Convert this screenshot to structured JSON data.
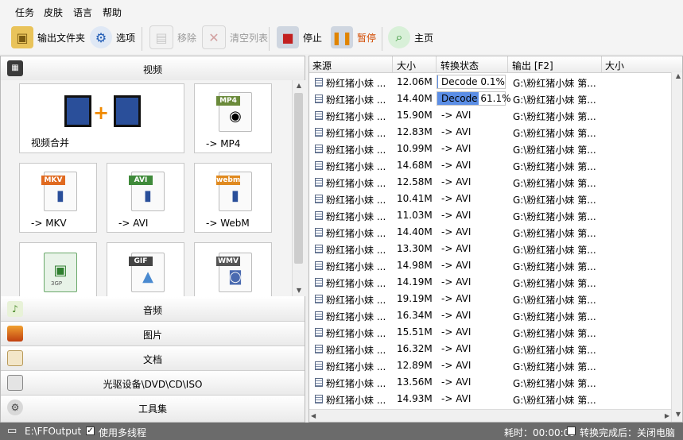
{
  "menu": [
    "任务",
    "皮肤",
    "语言",
    "帮助"
  ],
  "toolbar": {
    "output_folder": "输出文件夹",
    "options": "选项",
    "remove": "移除",
    "clear_list": "清空列表",
    "stop": "停止",
    "pause": "暂停",
    "home": "主页"
  },
  "categories": {
    "video": "视频",
    "audio": "音频",
    "image": "图片",
    "document": "文档",
    "disc": "光驱设备\\DVD\\CD\\ISO",
    "tools": "工具集"
  },
  "tiles": [
    {
      "label": "视频合并",
      "tag": ""
    },
    {
      "label": "-> MP4",
      "tag": "MP4"
    },
    {
      "label": "-> MKV",
      "tag": "MKV"
    },
    {
      "label": "-> AVI",
      "tag": "AVI"
    },
    {
      "label": "-> WebM",
      "tag": "webm"
    },
    {
      "label": "",
      "tag": "3GP"
    },
    {
      "label": "",
      "tag": "GIF"
    },
    {
      "label": "",
      "tag": "WMV"
    }
  ],
  "table": {
    "columns": [
      "来源",
      "大小",
      "转换状态",
      "输出 [F2]",
      "大小"
    ],
    "rows": [
      {
        "source": "粉红猪小妹 ...",
        "size": "12.06M",
        "status": "Decode 0.1%",
        "progress": 0.001,
        "output": "G:\\粉红猪小妹 第..."
      },
      {
        "source": "粉红猪小妹 ...",
        "size": "14.40M",
        "status": "Decode 61.1%",
        "progress": 0.611,
        "output": "G:\\粉红猪小妹 第..."
      },
      {
        "source": "粉红猪小妹 ...",
        "size": "15.90M",
        "status": "-> AVI",
        "output": "G:\\粉红猪小妹 第..."
      },
      {
        "source": "粉红猪小妹 ...",
        "size": "12.83M",
        "status": "-> AVI",
        "output": "G:\\粉红猪小妹 第..."
      },
      {
        "source": "粉红猪小妹 ...",
        "size": "10.99M",
        "status": "-> AVI",
        "output": "G:\\粉红猪小妹 第..."
      },
      {
        "source": "粉红猪小妹 ...",
        "size": "14.68M",
        "status": "-> AVI",
        "output": "G:\\粉红猪小妹 第..."
      },
      {
        "source": "粉红猪小妹 ...",
        "size": "12.58M",
        "status": "-> AVI",
        "output": "G:\\粉红猪小妹 第..."
      },
      {
        "source": "粉红猪小妹 ...",
        "size": "10.41M",
        "status": "-> AVI",
        "output": "G:\\粉红猪小妹 第..."
      },
      {
        "source": "粉红猪小妹 ...",
        "size": "11.03M",
        "status": "-> AVI",
        "output": "G:\\粉红猪小妹 第..."
      },
      {
        "source": "粉红猪小妹 ...",
        "size": "14.40M",
        "status": "-> AVI",
        "output": "G:\\粉红猪小妹 第..."
      },
      {
        "source": "粉红猪小妹 ...",
        "size": "13.30M",
        "status": "-> AVI",
        "output": "G:\\粉红猪小妹 第..."
      },
      {
        "source": "粉红猪小妹 ...",
        "size": "14.98M",
        "status": "-> AVI",
        "output": "G:\\粉红猪小妹 第..."
      },
      {
        "source": "粉红猪小妹 ...",
        "size": "14.19M",
        "status": "-> AVI",
        "output": "G:\\粉红猪小妹 第..."
      },
      {
        "source": "粉红猪小妹 ...",
        "size": "19.19M",
        "status": "-> AVI",
        "output": "G:\\粉红猪小妹 第..."
      },
      {
        "source": "粉红猪小妹 ...",
        "size": "16.34M",
        "status": "-> AVI",
        "output": "G:\\粉红猪小妹 第..."
      },
      {
        "source": "粉红猪小妹 ...",
        "size": "15.51M",
        "status": "-> AVI",
        "output": "G:\\粉红猪小妹 第..."
      },
      {
        "source": "粉红猪小妹 ...",
        "size": "16.32M",
        "status": "-> AVI",
        "output": "G:\\粉红猪小妹 第..."
      },
      {
        "source": "粉红猪小妹 ...",
        "size": "12.89M",
        "status": "-> AVI",
        "output": "G:\\粉红猪小妹 第..."
      },
      {
        "source": "粉红猪小妹 ...",
        "size": "13.56M",
        "status": "-> AVI",
        "output": "G:\\粉红猪小妹 第..."
      },
      {
        "source": "粉红猪小妹 ...",
        "size": "14.93M",
        "status": "-> AVI",
        "output": "G:\\粉红猪小妹 第..."
      }
    ]
  },
  "status": {
    "output_path": "E:\\FFOutput",
    "multithread": "使用多线程",
    "elapsed": "耗时：00:00:09",
    "after_done": "转换完成后：关闭电脑"
  },
  "colors": {
    "progress": "#5b8ee6",
    "statusbar": "#6b6b6b"
  }
}
